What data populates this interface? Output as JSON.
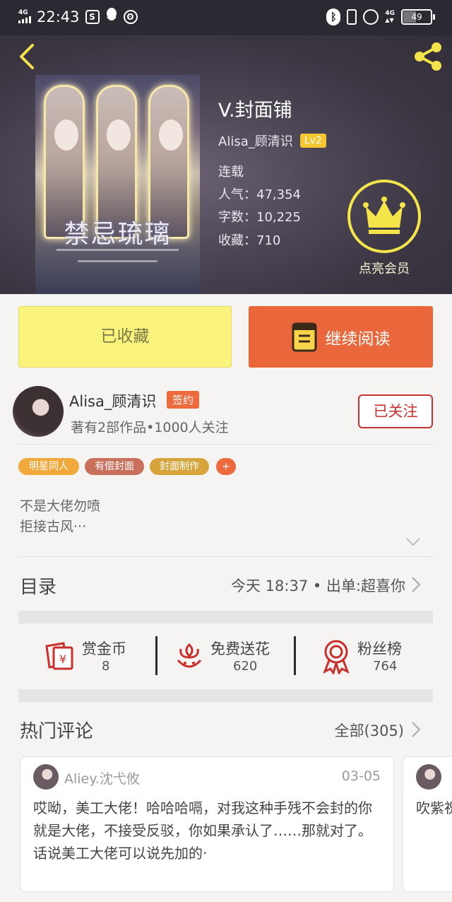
{
  "status_bar": {
    "network": "4G",
    "time": "22:43",
    "left_icons": [
      "s-box-icon",
      "qq-penguin-icon",
      "weibo-icon"
    ],
    "right_network": "4G",
    "battery": "49",
    "battery_level": 0.49
  },
  "header": {
    "book_title": "V.封面铺",
    "cover_art_title": "禁忌琉璃",
    "author": "Alisa_顾清识",
    "level": "Lv2",
    "status": "连载",
    "popularity_label": "人气：",
    "popularity": "47,354",
    "words_label": "字数：",
    "words": "10,225",
    "favorites_label": "收藏：",
    "favorites": "710",
    "vip_label": "点亮会员",
    "colors": {
      "crown": "#f5e54a",
      "level_badge": "#f4c630"
    }
  },
  "actions": {
    "favorited_label": "已收藏",
    "continue_label": "继续阅读",
    "colors": {
      "favorited_bg": "#fbf47c",
      "continue_bg": "#e9673a"
    }
  },
  "author_card": {
    "name": "Alisa_顾清识",
    "badge": "签约",
    "meta": "著有2部作品•1000人关注",
    "follow_label": "已关注",
    "tags": [
      {
        "label": "明星同人",
        "color": "#f2a93b"
      },
      {
        "label": "有偿封面",
        "color": "#c9705c"
      },
      {
        "label": "封面制作",
        "color": "#d6a43a"
      },
      {
        "label": "+",
        "color": "#ec6a3c"
      }
    ],
    "intro_lines": [
      "不是大佬勿喷",
      "拒接古风···"
    ]
  },
  "catalog": {
    "title": "目录",
    "update": "今天 18:37 • 出单:超喜你"
  },
  "stats": [
    {
      "icon": "red-envelope-yen-icon",
      "label": "赏金币",
      "value": "8"
    },
    {
      "icon": "flower-icon",
      "label": "免费送花",
      "value": "620"
    },
    {
      "icon": "award-ribbon-icon",
      "label": "粉丝榜",
      "value": "764"
    }
  ],
  "hot_comments": {
    "title": "热门评论",
    "all_label": "全部(305)",
    "items": [
      {
        "user": "Aliey.沈弋攸",
        "date": "03-05",
        "text": "哎呦，美工大佬！哈哈哈嗝，对我这种手残不会封的你就是大佬，不接受反驳，你如果承认了……那就对了。话说美工大佬可以说先加的·"
      },
      {
        "text": "吹紫祝"
      }
    ]
  }
}
